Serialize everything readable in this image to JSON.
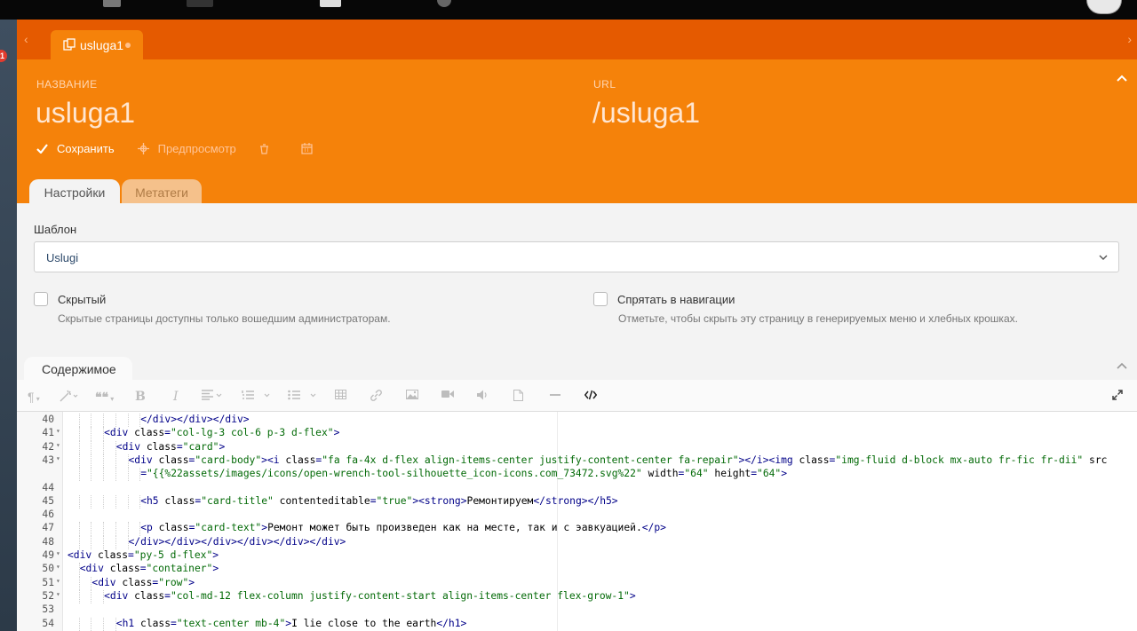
{
  "app": {
    "notification_count": "1",
    "document_tab": {
      "label": "usluga1"
    }
  },
  "header": {
    "name_label": "НАЗВАНИЕ",
    "name_value": "usluga1",
    "url_label": "URL",
    "url_value": "/usluga1",
    "actions": {
      "save": "Сохранить",
      "preview": "Предпросмотр"
    },
    "tabs": {
      "settings": "Настройки",
      "metatags": "Метатеги"
    }
  },
  "settings": {
    "template_label": "Шаблон",
    "template_value": "Uslugi",
    "hidden_label": "Скрытый",
    "hidden_help": "Скрытые страницы доступны только вошедшим администраторам.",
    "hide_nav_label": "Спрятать в навигации",
    "hide_nav_help": "Отметьте, чтобы скрыть эту страницу в генерируемых меню и хлебных крошках."
  },
  "content": {
    "section_label": "Содержимое",
    "toolbar": {
      "paragraph": "¶",
      "quote": "❝❝",
      "bold": "B",
      "italic": "I"
    },
    "lines": [
      {
        "n": "40",
        "fold": "",
        "indent": 6,
        "segs": [
          [
            "tag",
            "</div></div></div>"
          ]
        ]
      },
      {
        "n": "41",
        "fold": "▾",
        "indent": 3,
        "segs": [
          [
            "tag",
            "<div "
          ],
          [
            "attr",
            "class"
          ],
          [
            "tag",
            "="
          ],
          [
            "str",
            "\"col-lg-3 col-6 p-3 d-flex\""
          ],
          [
            "tag",
            ">"
          ]
        ]
      },
      {
        "n": "42",
        "fold": "▾",
        "indent": 4,
        "segs": [
          [
            "tag",
            "<div "
          ],
          [
            "attr",
            "class"
          ],
          [
            "tag",
            "="
          ],
          [
            "str",
            "\"card\""
          ],
          [
            "tag",
            ">"
          ]
        ]
      },
      {
        "n": "43",
        "fold": "▾",
        "indent": 5,
        "segs": [
          [
            "tag",
            "<div "
          ],
          [
            "attr",
            "class"
          ],
          [
            "tag",
            "="
          ],
          [
            "str",
            "\"card-body\""
          ],
          [
            "tag",
            "><i "
          ],
          [
            "attr",
            "class"
          ],
          [
            "tag",
            "="
          ],
          [
            "str",
            "\"fa fa-4x d-flex align-items-center justify-content-center fa-repair\""
          ],
          [
            "tag",
            "></i><img "
          ],
          [
            "attr",
            "class"
          ],
          [
            "tag",
            "="
          ],
          [
            "str",
            "\"img-fluid d-block mx-auto fr-fic fr-dii\""
          ],
          [
            "tag",
            " "
          ],
          [
            "attr",
            "src"
          ]
        ]
      },
      {
        "n": "",
        "fold": "",
        "indent": 6,
        "segs": [
          [
            "tag",
            "="
          ],
          [
            "str",
            "\"{{%22assets/images/icons/open-wrench-tool-silhouette_icon-icons.com_73472.svg%22\""
          ],
          [
            "tag",
            " "
          ],
          [
            "attr",
            "width"
          ],
          [
            "tag",
            "="
          ],
          [
            "str",
            "\"64\""
          ],
          [
            "tag",
            " "
          ],
          [
            "attr",
            "height"
          ],
          [
            "tag",
            "="
          ],
          [
            "str",
            "\"64\""
          ],
          [
            "tag",
            ">"
          ]
        ]
      },
      {
        "n": "44",
        "fold": "",
        "indent": 0,
        "segs": []
      },
      {
        "n": "45",
        "fold": "",
        "indent": 6,
        "segs": [
          [
            "tag",
            "<h5 "
          ],
          [
            "attr",
            "class"
          ],
          [
            "tag",
            "="
          ],
          [
            "str",
            "\"card-title\""
          ],
          [
            "tag",
            " "
          ],
          [
            "attr",
            "contenteditable"
          ],
          [
            "tag",
            "="
          ],
          [
            "str",
            "\"true\""
          ],
          [
            "tag",
            "><strong>"
          ],
          [
            "txt",
            "Ремонтируем"
          ],
          [
            "tag",
            "</strong></h5>"
          ]
        ]
      },
      {
        "n": "46",
        "fold": "",
        "indent": 0,
        "segs": []
      },
      {
        "n": "47",
        "fold": "",
        "indent": 6,
        "segs": [
          [
            "tag",
            "<p "
          ],
          [
            "attr",
            "class"
          ],
          [
            "tag",
            "="
          ],
          [
            "str",
            "\"card-text\""
          ],
          [
            "tag",
            ">"
          ],
          [
            "txt",
            "Ремонт может быть произведен как на месте, так и с эавкуацией."
          ],
          [
            "tag",
            "</p>"
          ]
        ]
      },
      {
        "n": "48",
        "fold": "",
        "indent": 5,
        "segs": [
          [
            "tag",
            "</div></div></div></div></div></div>"
          ]
        ]
      },
      {
        "n": "49",
        "fold": "▾",
        "indent": 0,
        "segs": [
          [
            "tag",
            "<div "
          ],
          [
            "attr",
            "class"
          ],
          [
            "tag",
            "="
          ],
          [
            "str",
            "\"py-5 d-flex\""
          ],
          [
            "tag",
            ">"
          ]
        ]
      },
      {
        "n": "50",
        "fold": "▾",
        "indent": 1,
        "segs": [
          [
            "tag",
            "<div "
          ],
          [
            "attr",
            "class"
          ],
          [
            "tag",
            "="
          ],
          [
            "str",
            "\"container\""
          ],
          [
            "tag",
            ">"
          ]
        ]
      },
      {
        "n": "51",
        "fold": "▾",
        "indent": 2,
        "segs": [
          [
            "tag",
            "<div "
          ],
          [
            "attr",
            "class"
          ],
          [
            "tag",
            "="
          ],
          [
            "str",
            "\"row\""
          ],
          [
            "tag",
            ">"
          ]
        ]
      },
      {
        "n": "52",
        "fold": "▾",
        "indent": 3,
        "segs": [
          [
            "tag",
            "<div "
          ],
          [
            "attr",
            "class"
          ],
          [
            "tag",
            "="
          ],
          [
            "str",
            "\"col-md-12 flex-column justify-content-start align-items-center flex-grow-1\""
          ],
          [
            "tag",
            ">"
          ]
        ]
      },
      {
        "n": "53",
        "fold": "",
        "indent": 0,
        "segs": []
      },
      {
        "n": "54",
        "fold": "",
        "indent": 4,
        "segs": [
          [
            "tag",
            "<h1 "
          ],
          [
            "attr",
            "class"
          ],
          [
            "tag",
            "="
          ],
          [
            "str",
            "\"text-center mb-4\""
          ],
          [
            "tag",
            ">"
          ],
          [
            "txt",
            "I lie close to the earth"
          ],
          [
            "tag",
            "</h1>"
          ]
        ]
      }
    ]
  }
}
